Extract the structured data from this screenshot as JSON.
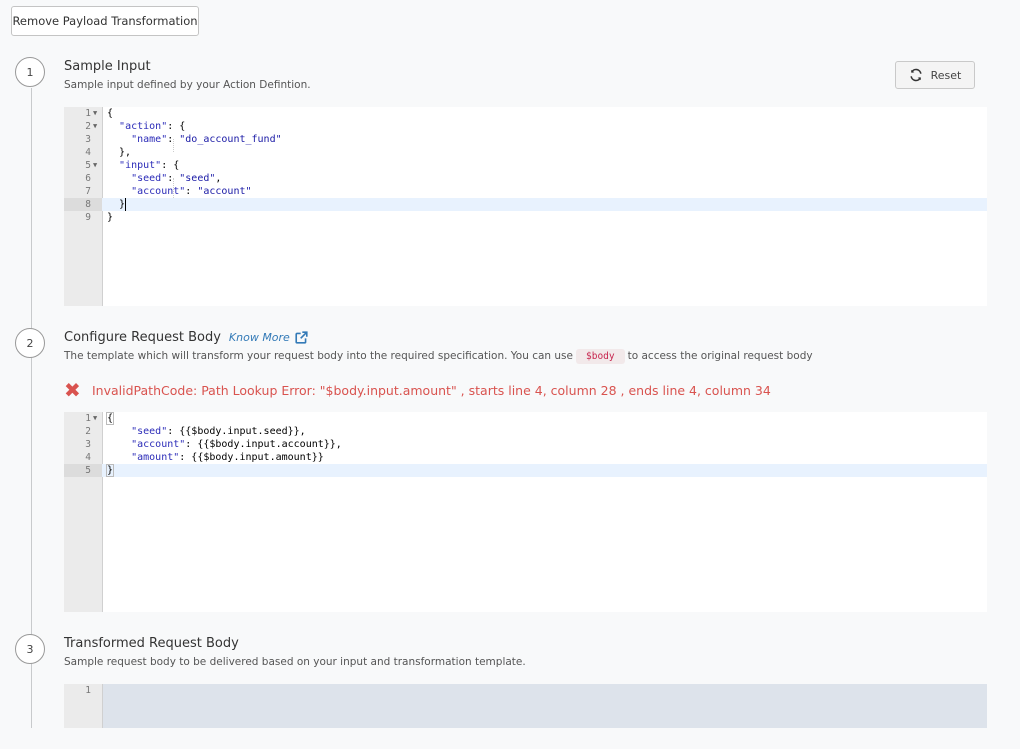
{
  "toolbar": {
    "remove_label": "Remove Payload Transformation"
  },
  "steps": [
    {
      "number": "1",
      "title": "Sample Input",
      "description": "Sample input defined by your Action Defintion."
    },
    {
      "number": "2",
      "title": "Configure Request Body",
      "know_more": "Know More",
      "description_before": "The template which will transform your request body into the required specification. You can use",
      "code_chip": "$body",
      "description_after": "to access the original request body"
    },
    {
      "number": "3",
      "title": "Transformed Request Body",
      "description": "Sample request body to be delivered based on your input and transformation template."
    }
  ],
  "reset": {
    "label": "Reset",
    "icon": "refresh-icon"
  },
  "error": {
    "icon": "x-icon",
    "message": "InvalidPathCode: Path Lookup Error: \"$body.input.amount\" , starts line 4, column 28 , ends line 4, column 34"
  },
  "editor1": {
    "line_numbers": [
      "1",
      "2",
      "3",
      "4",
      "5",
      "6",
      "7",
      "8",
      "9"
    ],
    "lines": [
      {
        "before": "{",
        "key": "",
        "after": ""
      },
      {
        "before": "  ",
        "key": "\"action\"",
        "after": ": {"
      },
      {
        "before": "    ",
        "key": "\"name\"",
        "after": ": ",
        "value": "\"do_account_fund\""
      },
      {
        "before": "  },",
        "key": "",
        "after": ""
      },
      {
        "before": "  ",
        "key": "\"input\"",
        "after": ": {"
      },
      {
        "before": "    ",
        "key": "\"seed\"",
        "after": ": ",
        "value": "\"seed\"",
        "tail": ","
      },
      {
        "before": "    ",
        "key": "\"account\"",
        "after": ": ",
        "value": "\"account\""
      },
      {
        "before": "  }",
        "key": "",
        "after": ""
      },
      {
        "before": "}",
        "key": "",
        "after": ""
      }
    ]
  },
  "editor2": {
    "line_numbers": [
      "1",
      "2",
      "3",
      "4",
      "5"
    ],
    "lines": [
      {
        "before": "{",
        "key": "",
        "after": ""
      },
      {
        "before": "    ",
        "key": "\"seed\"",
        "after": ": {{$body.input.seed}},"
      },
      {
        "before": "    ",
        "key": "\"account\"",
        "after": ": {{$body.input.account}},"
      },
      {
        "before": "    ",
        "key": "\"amount\"",
        "after": ": {{$body.input.amount}}"
      },
      {
        "before": "}",
        "key": "",
        "after": ""
      }
    ]
  },
  "editor3": {
    "line_numbers": [
      "1"
    ]
  }
}
